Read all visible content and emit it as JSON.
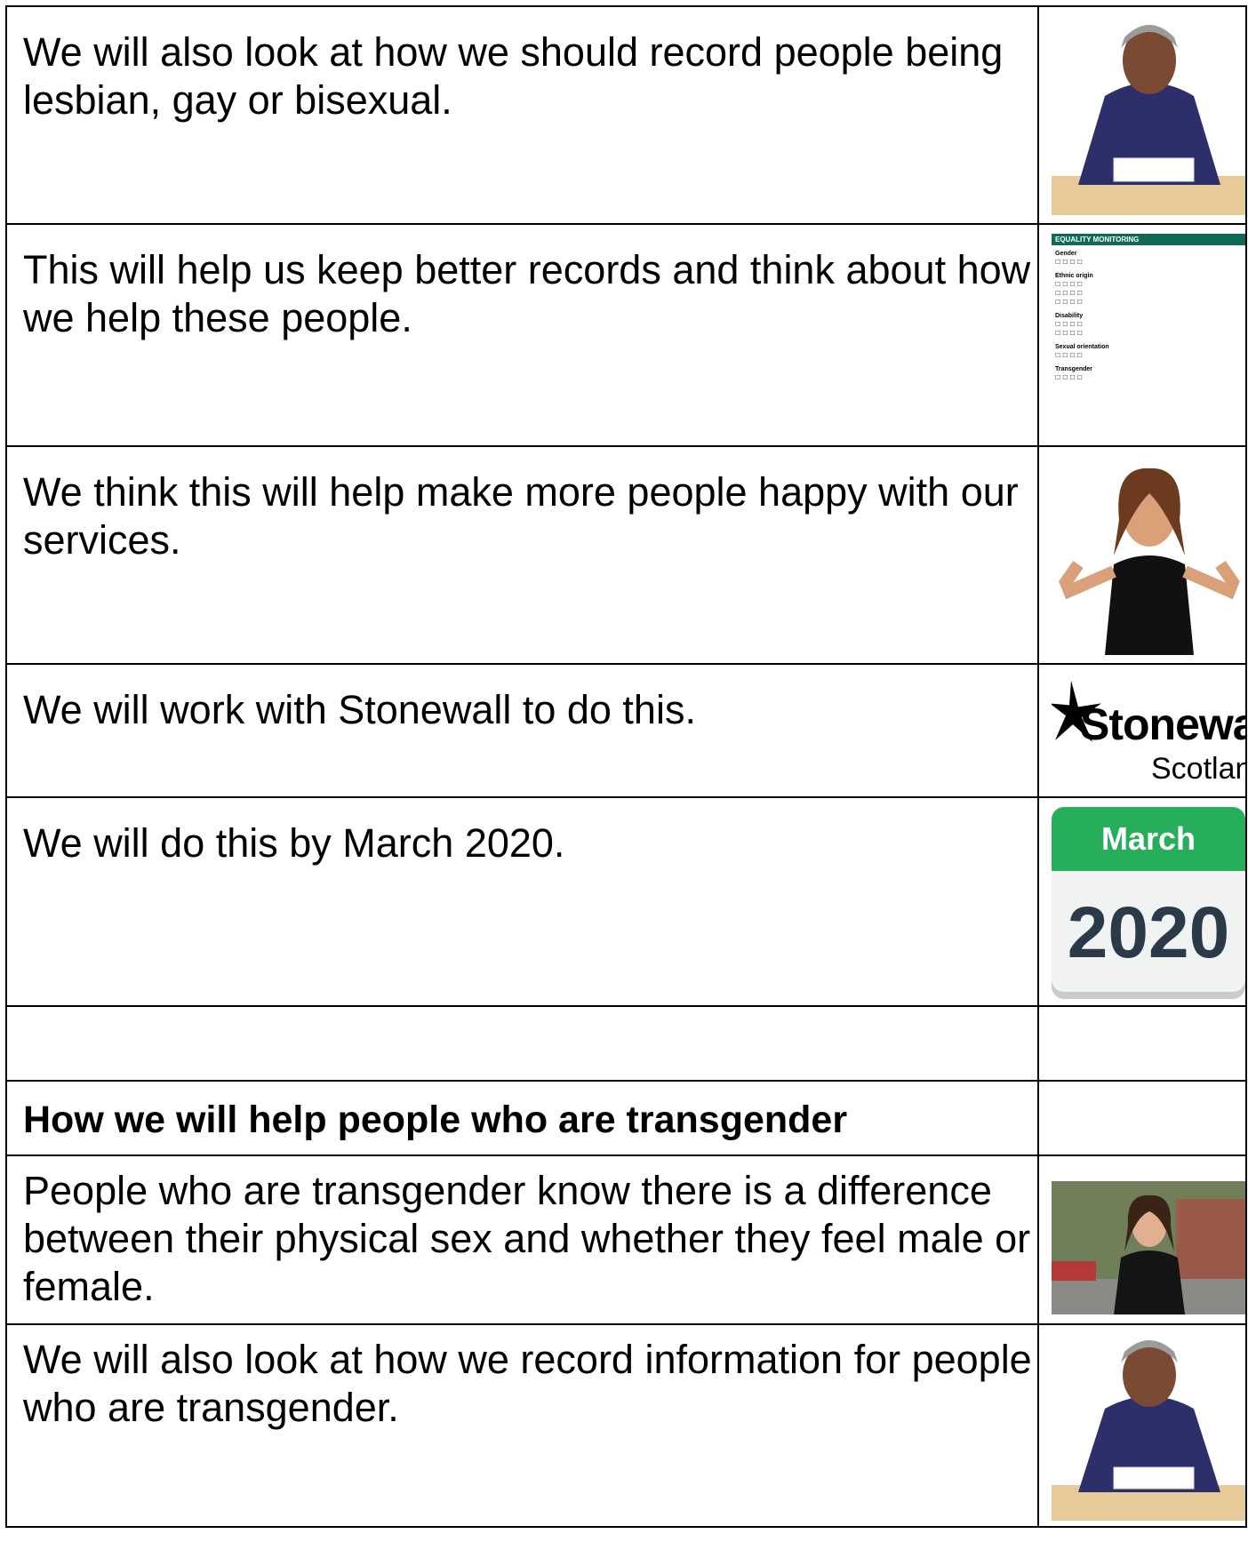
{
  "rows": [
    {
      "text": "We will also look at how we should record people being lesbian, gay or bisexual.",
      "picture": "woman-writing-image"
    },
    {
      "text": "This will help us keep better records and think about how we help these people.",
      "picture": "equality-form-image"
    },
    {
      "text": "We think this will help make more people happy with our services.",
      "picture": "thumbs-up-image"
    },
    {
      "text": "We will work with Stonewall to do this.",
      "picture": "stonewall-logo"
    },
    {
      "text": "We will do this by March 2020.",
      "picture": "calendar-image"
    },
    {
      "text": "",
      "picture": ""
    },
    {
      "text": "How we will help people who are transgender",
      "picture": ""
    },
    {
      "text": "People who are transgender know there is a difference between their physical sex and whether they feel male or female.",
      "picture": "person-outdoors-image"
    },
    {
      "text": "We will also look at how we record information for people who are transgender.",
      "picture": "woman-writing-image"
    }
  ],
  "logo": {
    "name": "Stonewall",
    "region": "Scotland"
  },
  "calendar": {
    "month": "March",
    "year": "2020"
  },
  "form": {
    "title": "EQUALITY MONITORING",
    "sections": [
      "Gender",
      "Ethnic origin",
      "Disability",
      "Sexual orientation",
      "Transgender"
    ]
  },
  "colors": {
    "calendar_header": "#27ae5a",
    "calendar_year": "#2b3a48",
    "form_header": "#0f6a55",
    "border": "#000000"
  }
}
